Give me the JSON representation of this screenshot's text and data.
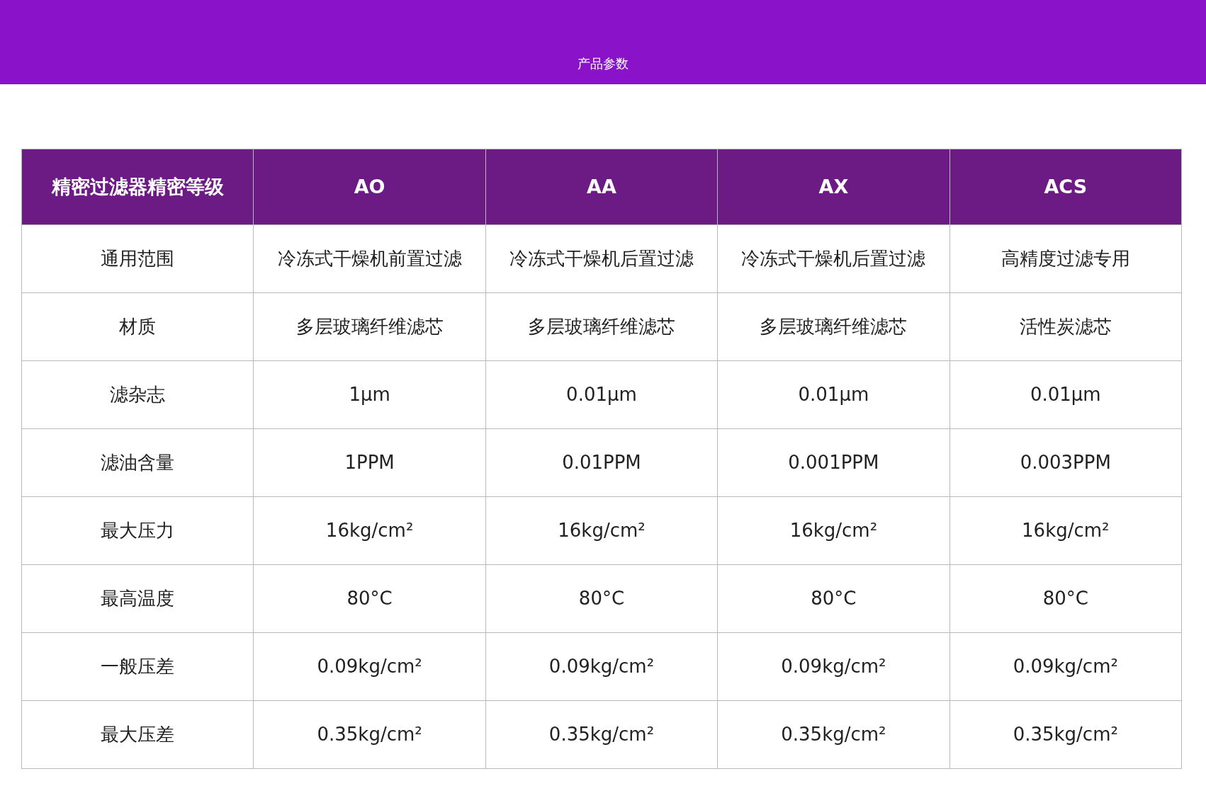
{
  "banner": {
    "title": "产品参数"
  },
  "table": {
    "columns": [
      "精密过滤器精密等级",
      "AO",
      "AA",
      "AX",
      "ACS"
    ],
    "rows": [
      [
        "通用范围",
        "冷冻式干燥机前置过滤",
        "冷冻式干燥机后置过滤",
        "冷冻式干燥机后置过滤",
        "高精度过滤专用"
      ],
      [
        "材质",
        "多层玻璃纤维滤芯",
        "多层玻璃纤维滤芯",
        "多层玻璃纤维滤芯",
        "活性炭滤芯"
      ],
      [
        "滤杂志",
        "1μm",
        "0.01μm",
        "0.01μm",
        "0.01μm"
      ],
      [
        "滤油含量",
        "1PPM",
        "0.01PPM",
        "0.001PPM",
        "0.003PPM"
      ],
      [
        "最大压力",
        "16kg/cm²",
        "16kg/cm²",
        "16kg/cm²",
        "16kg/cm²"
      ],
      [
        "最高温度",
        "80°C",
        "80°C",
        "80°C",
        "80°C"
      ],
      [
        "一般压差",
        "0.09kg/cm²",
        "0.09kg/cm²",
        "0.09kg/cm²",
        "0.09kg/cm²"
      ],
      [
        "最大压差",
        "0.35kg/cm²",
        "0.35kg/cm²",
        "0.35kg/cm²",
        "0.35kg/cm²"
      ]
    ]
  }
}
